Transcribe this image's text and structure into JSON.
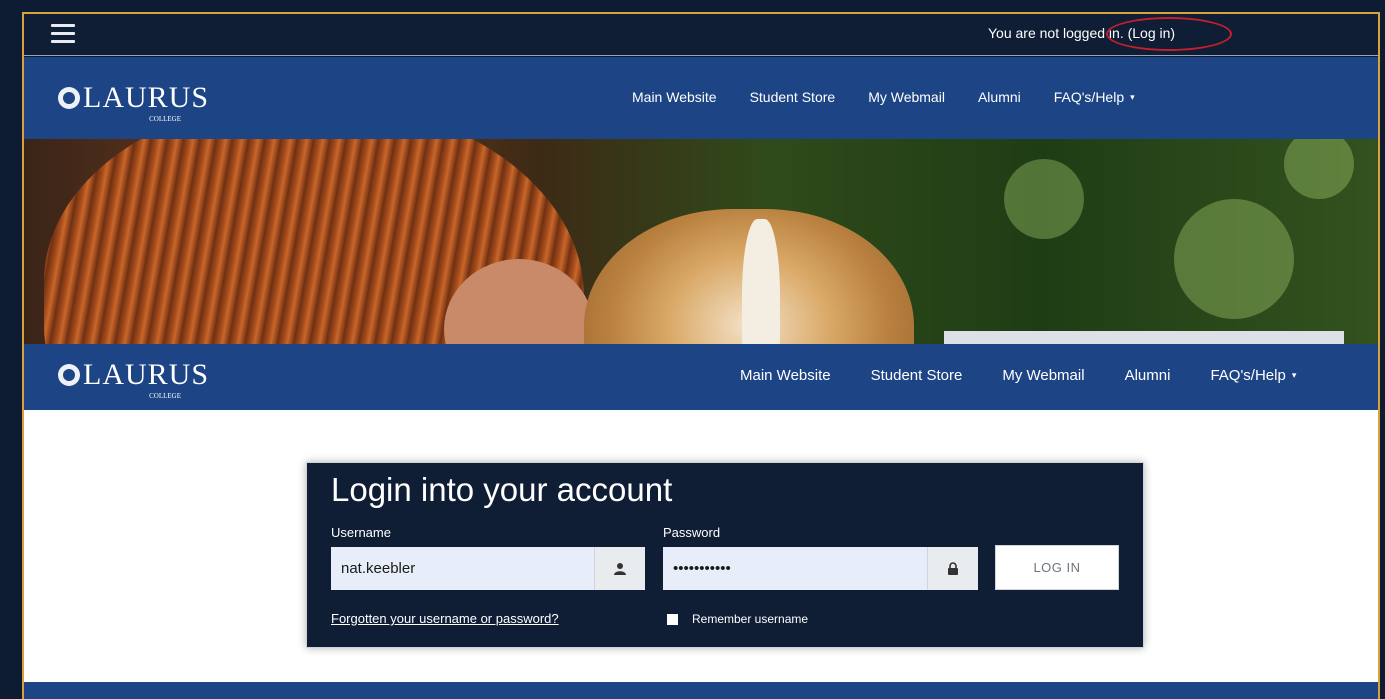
{
  "topbar": {
    "status_prefix": "You are not logged in.",
    "login_link": "(Log in)"
  },
  "brand": {
    "name": "LAURUS",
    "sub": "COLLEGE"
  },
  "nav": {
    "items": [
      "Main Website",
      "Student Store",
      "My Webmail",
      "Alumni",
      "FAQ's/Help"
    ],
    "dropdown_caret": "▾"
  },
  "login": {
    "title": "Login into your account",
    "username_label": "Username",
    "username_value": "nat.keebler",
    "password_label": "Password",
    "password_value": "•••••••••••",
    "button_label": "LOG IN",
    "forgot_link": "Forgotten your username or password?",
    "remember_label": "Remember username"
  },
  "colors": {
    "page_bg": "#0d1b33",
    "nav_bg": "#1d4484",
    "card_bg": "#0f1d35",
    "frame_border": "#d9a13b",
    "highlight_circle": "#c41f2d"
  },
  "icons": {
    "menu": "hamburger-icon",
    "username": "user-icon",
    "password": "lock-icon"
  }
}
